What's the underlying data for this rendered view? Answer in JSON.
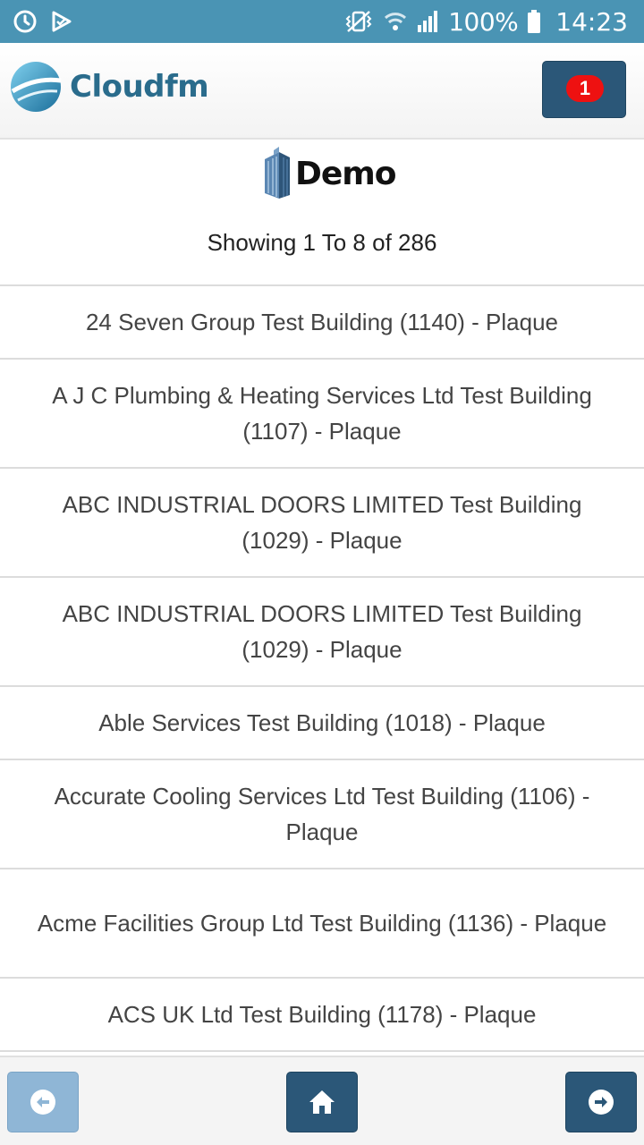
{
  "status_bar": {
    "battery_percent": "100%",
    "time": "14:23",
    "icons": [
      "sync-icon",
      "check-flag-icon",
      "vibrate-icon",
      "wifi-icon",
      "signal-icon",
      "battery-icon"
    ]
  },
  "header": {
    "brand": "Cloudfm",
    "notification_count": "1"
  },
  "org": {
    "name": "Demo",
    "showing": "Showing 1 To 8 of 286"
  },
  "buildings": [
    "24 Seven Group Test Building (1140) - Plaque",
    "A J C Plumbing & Heating Services Ltd Test Building (1107) - Plaque",
    "ABC INDUSTRIAL DOORS LIMITED Test Building (1029) - Plaque",
    "ABC INDUSTRIAL DOORS LIMITED Test Building (1029) - Plaque",
    "Able Services Test Building (1018) - Plaque",
    "Accurate Cooling Services Ltd Test Building (1106) - Plaque",
    "Acme Facilities Group Ltd Test Building (1136) - Plaque",
    "ACS UK Ltd Test Building (1178) - Plaque"
  ],
  "nav": {
    "back_icon": "arrow-left-circle-icon",
    "home_icon": "home-icon",
    "next_icon": "arrow-right-circle-icon"
  },
  "colors": {
    "status_bar": "#4a94b4",
    "primary_button": "#2b5778",
    "disabled_button": "#8fb6d6",
    "badge": "#ee1111",
    "brand_text": "#2a6c8c"
  }
}
